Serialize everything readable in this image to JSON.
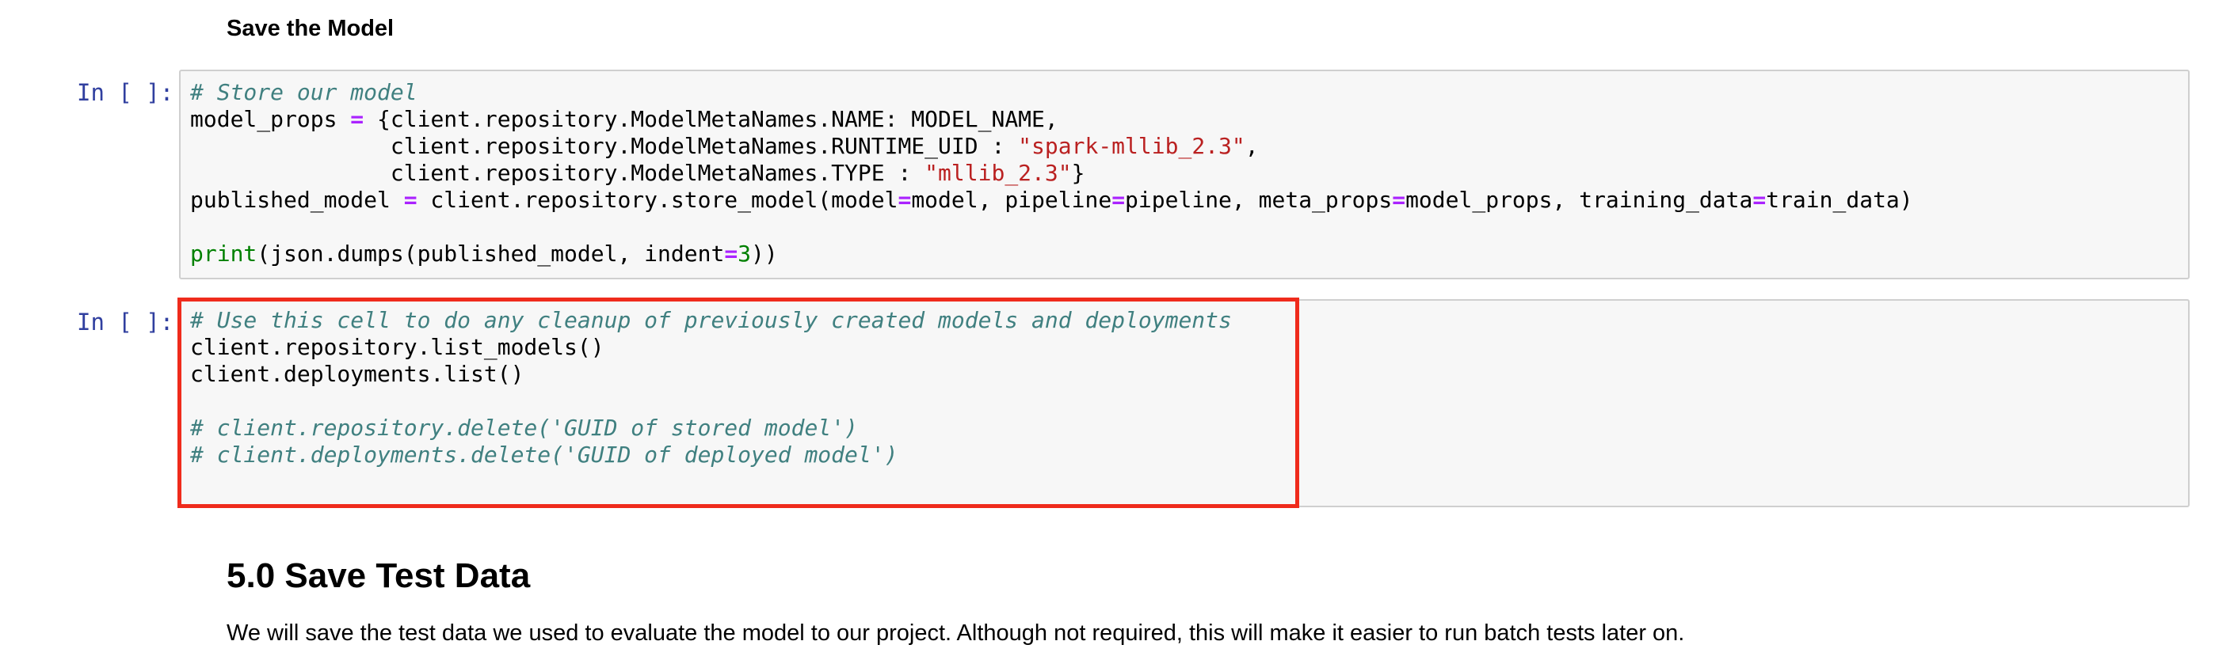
{
  "notebook": {
    "cells": [
      {
        "type": "markdown",
        "subheading": "Save the Model"
      },
      {
        "type": "code",
        "prompt": "In [ ]:",
        "lines": [
          [
            {
              "t": "comment",
              "v": "# Store our model"
            }
          ],
          [
            {
              "t": "text",
              "v": "model_props "
            },
            {
              "t": "op",
              "v": "="
            },
            {
              "t": "text",
              "v": " {client.repository.ModelMetaNames.NAME: MODEL_NAME,"
            }
          ],
          [
            {
              "t": "text",
              "v": "               client.repository.ModelMetaNames.RUNTIME_UID : "
            },
            {
              "t": "str",
              "v": "\"spark-mllib_2.3\""
            },
            {
              "t": "text",
              "v": ","
            }
          ],
          [
            {
              "t": "text",
              "v": "               client.repository.ModelMetaNames.TYPE : "
            },
            {
              "t": "str",
              "v": "\"mllib_2.3\""
            },
            {
              "t": "text",
              "v": "}"
            }
          ],
          [
            {
              "t": "text",
              "v": "published_model "
            },
            {
              "t": "op",
              "v": "="
            },
            {
              "t": "text",
              "v": " client.repository.store_model(model"
            },
            {
              "t": "op",
              "v": "="
            },
            {
              "t": "text",
              "v": "model, pipeline"
            },
            {
              "t": "op",
              "v": "="
            },
            {
              "t": "text",
              "v": "pipeline, meta_props"
            },
            {
              "t": "op",
              "v": "="
            },
            {
              "t": "text",
              "v": "model_props, training_data"
            },
            {
              "t": "op",
              "v": "="
            },
            {
              "t": "text",
              "v": "train_data)"
            }
          ],
          [],
          [
            {
              "t": "builtin",
              "v": "print"
            },
            {
              "t": "text",
              "v": "(json.dumps(published_model, indent"
            },
            {
              "t": "op",
              "v": "="
            },
            {
              "t": "num",
              "v": "3"
            },
            {
              "t": "text",
              "v": "))"
            }
          ]
        ]
      },
      {
        "type": "code",
        "prompt": "In [ ]:",
        "highlighted": true,
        "highlight_color": "#ef2b1c",
        "lines": [
          [
            {
              "t": "comment",
              "v": "# Use this cell to do any cleanup of previously created models and deployments"
            }
          ],
          [
            {
              "t": "text",
              "v": "client.repository.list_models()"
            }
          ],
          [
            {
              "t": "text",
              "v": "client.deployments.list()"
            }
          ],
          [],
          [
            {
              "t": "comment",
              "v": "# client.repository.delete('GUID of stored model')"
            }
          ],
          [
            {
              "t": "comment",
              "v": "# client.deployments.delete('GUID of deployed model')"
            }
          ]
        ]
      },
      {
        "type": "markdown",
        "heading": "5.0 Save Test Data",
        "paragraph": "We will save the test data we used to evaluate the model to our project. Although not required, this will make it easier to run batch tests later on."
      }
    ]
  },
  "colors": {
    "prompt": "#303f9f",
    "cell_background": "#f7f7f7",
    "cell_border": "#cfcfcf",
    "comment": "#408080",
    "operator": "#aa22ff",
    "string": "#ba2121",
    "builtin": "#008000"
  }
}
